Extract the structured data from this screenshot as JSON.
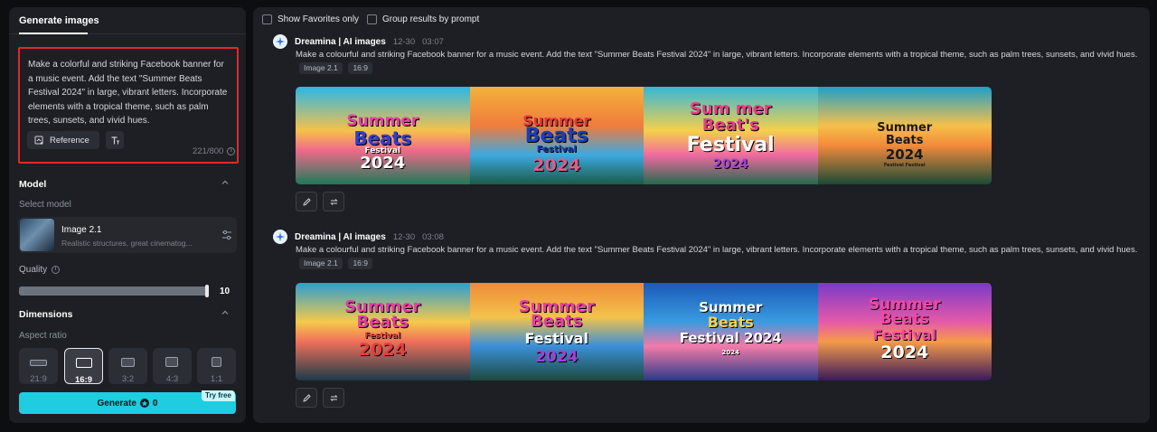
{
  "sidebar": {
    "tab_label": "Generate images",
    "prompt_text": "Make a colorful and striking Facebook banner for a music event. Add the text \"Summer Beats Festival 2024\" in large, vibrant letters. Incorporate elements with a tropical theme, such as palm trees, sunsets, and vivid hues.",
    "reference_label": "Reference",
    "char_count": "221/800",
    "model_section": "Model",
    "select_model_label": "Select model",
    "model_name": "Image 2.1",
    "model_desc": "Realistic structures, great cinematog...",
    "quality_label": "Quality",
    "quality_value": "10",
    "quality_fraction": 1.0,
    "dimensions_section": "Dimensions",
    "aspect_ratio_label": "Aspect ratio",
    "aspect_ratios": [
      "21:9",
      "16:9",
      "3:2",
      "4:3",
      "1:1"
    ],
    "selected_ratio": "16:9",
    "generate_label": "Generate",
    "generate_cost": "0",
    "try_free_label": "Try free"
  },
  "main": {
    "show_favorites_label": "Show Favorites only",
    "group_by_prompt_label": "Group results by prompt",
    "groups": [
      {
        "source": "Dreamina | AI images",
        "date": "12-30",
        "time": "03:07",
        "prompt": "Make a colourful and striking Facebook banner for a music event. Add the text \"Summer Beats Festival 2024\" in large, vibrant letters. Incorporate elements with a tropical theme, such as palm trees, sunsets, and vivid hues.",
        "tags": [
          "Image 2.1",
          "16:9"
        ],
        "images": [
          {
            "l1": "Summer",
            "l2": "Beats",
            "l3": "Festival",
            "l4": "2024"
          },
          {
            "l1": "Summer",
            "l2": "Beats",
            "l3": "Festival",
            "l4": "2024"
          },
          {
            "l1": "Sum mer",
            "l2": "Beat's",
            "l3": "Festival",
            "l4": "2024"
          },
          {
            "l1": "Summer",
            "l2": "Beats",
            "l3": "2024",
            "l4": "Festival Festival"
          }
        ]
      },
      {
        "source": "Dreamina | AI images",
        "date": "12-30",
        "time": "03:08",
        "prompt": "Make a colourful and striking Facebook banner for a music event. Add the text \"Summer Beats Festival 2024\" in large, vibrant letters. Incorporate elements with a tropical theme, such as palm trees, sunsets, and vivid hues.",
        "tags": [
          "Image 2.1",
          "16:9"
        ],
        "images": [
          {
            "l1": "Summer",
            "l2": "Beats",
            "l3": "Festival",
            "l4": "2024"
          },
          {
            "l1": "Summer",
            "l2": "Beats",
            "l3": "Festival",
            "l4": "2024"
          },
          {
            "l1": "Summer",
            "l2": "Beats",
            "l3": "Festival 2024",
            "l4": "2024"
          },
          {
            "l1": "Summer",
            "l2": "Beats",
            "l3": "Festival",
            "l4": "2024"
          }
        ]
      }
    ]
  },
  "colors": {
    "accent": "#1ecde0",
    "panel": "#1d1f24",
    "background": "#0d0e12",
    "highlight_border": "#e02929"
  },
  "icons": {
    "reference": "reference-icon",
    "text": "text-icon",
    "info": "info-icon",
    "chevron": "chevron-up-icon",
    "tune": "sliders-icon",
    "edit": "pencil-icon",
    "regenerate": "regenerate-icon",
    "logo": "dreamina-logo-icon"
  }
}
